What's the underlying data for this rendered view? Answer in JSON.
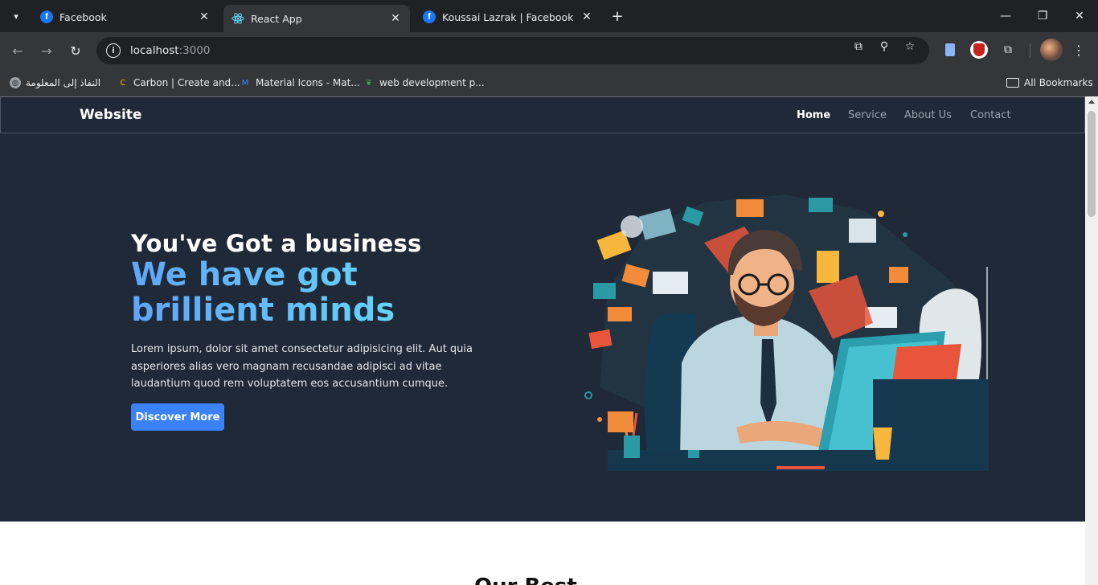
{
  "browser": {
    "tabs": [
      {
        "title": "Facebook",
        "icon": "facebook-icon",
        "active": false
      },
      {
        "title": "React App",
        "icon": "react-icon",
        "active": true
      },
      {
        "title": "Koussai Lazrak | Facebook",
        "icon": "facebook-icon",
        "active": false
      }
    ],
    "url": {
      "host": "localhost",
      "port": ":3000"
    },
    "bookmarks": [
      {
        "label": "النفاذ إلى المعلومة",
        "icon": "globe-icon"
      },
      {
        "label": "Carbon | Create and...",
        "icon": "carbon-icon"
      },
      {
        "label": "Material Icons - Mat...",
        "icon": "material-icon"
      },
      {
        "label": "web development p...",
        "icon": "leaf-icon"
      }
    ],
    "all_bookmarks": "All Bookmarks"
  },
  "site": {
    "brand": "Website",
    "nav": [
      "Home",
      "Service",
      "About Us",
      "Contact"
    ],
    "active_nav": "Home"
  },
  "hero": {
    "headline": "You've Got a business",
    "subheadline": "We have got brillient minds",
    "body": "Lorem ipsum, dolor sit amet consectetur adipisicing elit. Aut quia asperiores alias vero magnam recusandae adipisci ad vitae laudantium quod rem voluptatem eos accusantium cumque.",
    "cta": "Discover More"
  },
  "next_section": {
    "title": "Our Best..."
  },
  "colors": {
    "page_dark": "#1f2937",
    "accent_blue": "#3b82f6",
    "gradient_start": "#60a5fa",
    "gradient_end": "#67e8f9"
  }
}
